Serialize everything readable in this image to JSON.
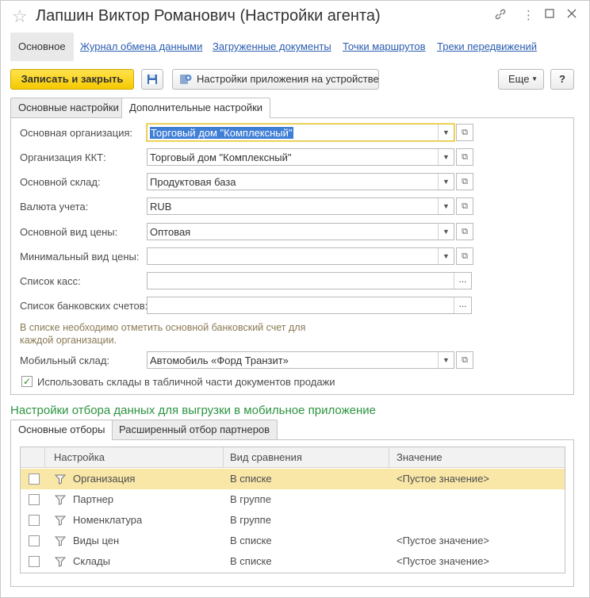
{
  "window": {
    "title": "Лапшин Виктор Романович (Настройки агента)",
    "icons": [
      "star-icon",
      "link-icon",
      "more-icon",
      "maximize-icon",
      "close-icon"
    ]
  },
  "nav": {
    "items": [
      {
        "label": "Основное",
        "active": true
      },
      {
        "label": "Журнал обмена данными",
        "active": false
      },
      {
        "label": "Загруженные документы",
        "active": false
      },
      {
        "label": "Точки маршрутов",
        "active": false
      },
      {
        "label": "Треки передвижений",
        "active": false
      }
    ]
  },
  "toolbar": {
    "save_close": "Записать и закрыть",
    "save_icon": "floppy-icon",
    "device_settings": "Настройки приложения на устройстве",
    "more": "Еще",
    "help": "?"
  },
  "tabs_top": [
    {
      "label": "Основные настройки",
      "active": false
    },
    {
      "label": "Дополнительные настройки",
      "active": true
    }
  ],
  "form": {
    "main_org": {
      "label": "Основная организация:",
      "value": "Торговый дом \"Комплексный\""
    },
    "kkt_org": {
      "label": "Организация ККТ:",
      "value": "Торговый дом \"Комплексный\""
    },
    "main_warehouse": {
      "label": "Основной склад:",
      "value": "Продуктовая база"
    },
    "currency": {
      "label": "Валюта учета:",
      "value": "RUB"
    },
    "price_type": {
      "label": "Основной вид цены:",
      "value": "Оптовая"
    },
    "min_price_type": {
      "label": "Минимальный вид цены:",
      "value": ""
    },
    "cash_list": {
      "label": "Список касс:",
      "value": ""
    },
    "bank_list": {
      "label": "Список банковских счетов:",
      "value": ""
    },
    "hint": "В списке необходимо отметить основной банковский счет для каждой организации.",
    "mobile_warehouse": {
      "label": "Мобильный склад:",
      "value": "Автомобиль «Форд Транзит»"
    },
    "use_warehouses": {
      "label": "Использовать склады в табличной части документов продажи",
      "checked": true
    }
  },
  "filters": {
    "section_title": "Настройки отбора данных для выгрузки в мобильное приложение",
    "tabs": [
      {
        "label": "Основные отборы",
        "active": true
      },
      {
        "label": "Расширенный отбор партнеров",
        "active": false
      }
    ],
    "columns": [
      "Настройка",
      "Вид сравнения",
      "Значение"
    ],
    "rows": [
      {
        "name": "Организация",
        "comparison": "В списке",
        "value": "<Пустое значение>",
        "checked": false,
        "selected": true
      },
      {
        "name": "Партнер",
        "comparison": "В группе",
        "value": "",
        "checked": false,
        "selected": false
      },
      {
        "name": "Номенклатура",
        "comparison": "В группе",
        "value": "",
        "checked": false,
        "selected": false
      },
      {
        "name": "Виды цен",
        "comparison": "В списке",
        "value": "<Пустое значение>",
        "checked": false,
        "selected": false
      },
      {
        "name": "Склады",
        "comparison": "В списке",
        "value": "<Пустое значение>",
        "checked": false,
        "selected": false
      }
    ]
  },
  "colors": {
    "accent_yellow": "#f5c900",
    "section_green": "#2c9440",
    "link_blue": "#2a5db0",
    "selected_row": "#f9e7a8"
  }
}
